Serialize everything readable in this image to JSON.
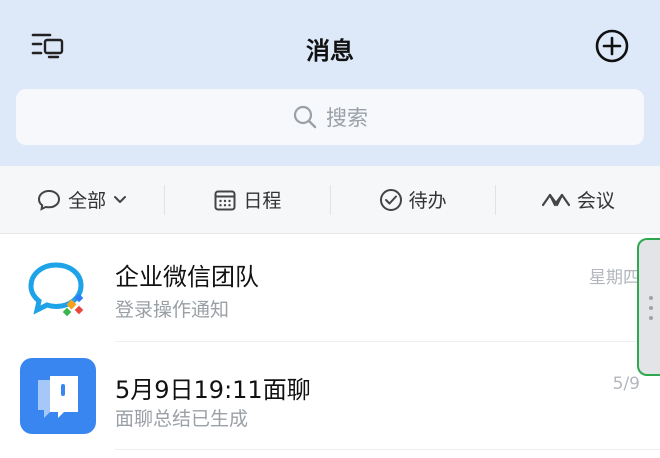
{
  "header": {
    "title": "消息",
    "menu_icon": "menu-monitor-icon",
    "add_icon": "plus-circle-icon"
  },
  "search": {
    "placeholder": "搜索",
    "icon": "search-icon"
  },
  "filters": [
    {
      "label": "全部",
      "icon": "chat-bubble-icon",
      "has_dropdown": true
    },
    {
      "label": "日程",
      "icon": "calendar-icon"
    },
    {
      "label": "待办",
      "icon": "check-circle-icon"
    },
    {
      "label": "会议",
      "icon": "meeting-icon"
    }
  ],
  "messages": [
    {
      "title": "企业微信团队",
      "subtitle": "登录操作通知",
      "time": "星期四",
      "avatar": "wecom-logo-icon"
    },
    {
      "title": "5月9日19:11面聊",
      "subtitle": "面聊总结已生成",
      "time": "5/9",
      "avatar": "interview-app-icon"
    }
  ],
  "colors": {
    "header_bg": "#dde8f9",
    "filter_bg": "#f6f7f9",
    "accent_blue": "#3a86f0",
    "handle_border": "#2ea84f"
  }
}
